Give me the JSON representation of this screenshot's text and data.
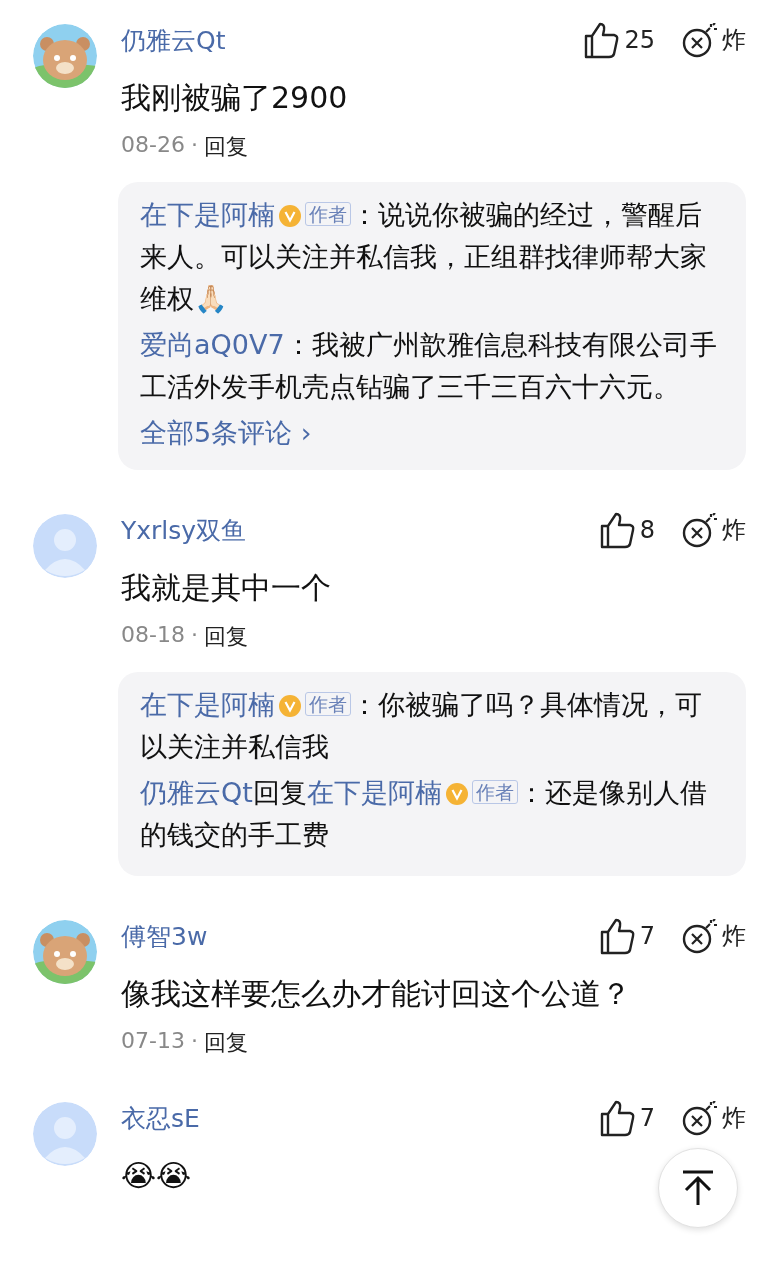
{
  "comments": [
    {
      "author": "仍雅云Qt",
      "likes": "25",
      "bomb": "炸",
      "text": "我刚被骗了2900",
      "date": "08-26",
      "separator": "·",
      "reply": "回复",
      "thread": {
        "replies": [
          {
            "author": "在下是阿楠",
            "verified": true,
            "author_tag": "作者",
            "text": "：说说你被骗的经过，警醒后来人。可以关注并私信我，正组群找律师帮大家维权🙏🏻"
          },
          {
            "author": "爱尚aQ0V7",
            "verified": false,
            "text": "：我被广州歆雅信息科技有限公司手工活外发手机壳点钻骗了三千三百六十六元。"
          }
        ],
        "more": "全部5条评论",
        "more_arrow": "›"
      }
    },
    {
      "avatar": {
        "kind": "default"
      },
      "author": "Yxrlsy双鱼",
      "likes": "8",
      "bomb": "炸",
      "text": "我就是其中一个",
      "date": "08-18",
      "separator": "·",
      "reply": "回复",
      "thread": {
        "replies": [
          {
            "author": "在下是阿楠",
            "verified": true,
            "author_tag": "作者",
            "text": "：你被骗了吗？具体情况，可以关注并私信我"
          },
          {
            "author": "仍雅云Qt",
            "verified": false,
            "reply_word": "回复",
            "reply_to": {
              "name": "在下是阿楠",
              "verified": true,
              "author_tag": "作者"
            },
            "text": "：还是像别人借的钱交的手工费"
          }
        ]
      }
    },
    {
      "author": "傅智3w",
      "likes": "7",
      "bomb": "炸",
      "text": "像我这样要怎么办才能讨回这个公道？",
      "date": "07-13",
      "separator": "·",
      "reply": "回复"
    },
    {
      "avatar": {
        "kind": "default"
      },
      "author": "衣忍sE",
      "likes": "7",
      "bomb": "炸",
      "text": "😭😭"
    }
  ]
}
